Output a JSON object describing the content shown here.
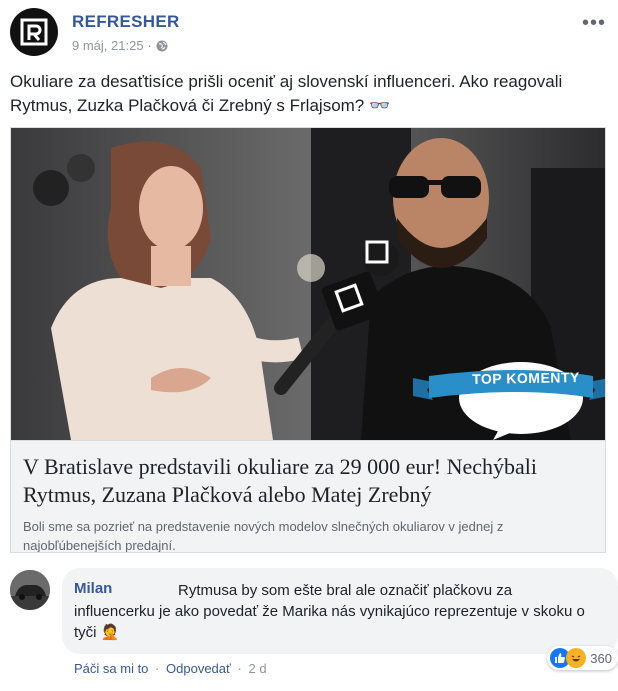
{
  "post": {
    "page_name": "REFRESHER",
    "timestamp": "9 máj, 21:25",
    "privacy_separator": "·",
    "more_label": "•••",
    "text": "Okuliare za desaťtisíce prišli oceniť aj slovenskí influenceri. Ako reagovali Rytmus, Zuzka Plačková či Zrebný s Frlajsom? 👓"
  },
  "link_card": {
    "banner_text": "TOP KOMENTY",
    "title": "V Bratislave predstavili okuliare za 29 000 eur! Nechýbali Rytmus, Zuzana Plačková alebo Matej Zrebný",
    "description": "Boli sme sa pozrieť na predstavenie nových modelov slnečných okuliarov v jednej z najobľúbenejších predajní."
  },
  "comment": {
    "author": "Milan",
    "text": "Rytmusa by som ešte bral ale označiť plačkovu za influencerku je ako povedať že Marika nás vynikajúco reprezentuje v skoku o tyči 🤦",
    "reaction_count": "360",
    "like_label": "Páči sa mi to",
    "reply_label": "Odpovedať",
    "age": "2 d",
    "separator": "·"
  },
  "colors": {
    "link_blue": "#385898",
    "page_name_blue": "#365899",
    "meta_gray": "#90949c",
    "card_bg": "#f2f3f5",
    "banner_blue": "#2a8fc8"
  }
}
